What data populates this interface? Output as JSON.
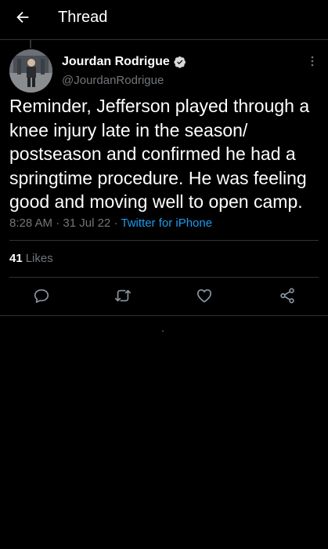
{
  "header": {
    "back_icon": "arrow-left-icon",
    "title": "Thread"
  },
  "tweet": {
    "author": {
      "display_name": "Jourdan Rodrigue",
      "handle": "@JourdanRodrigue",
      "verified": true,
      "avatar_icon": "profile-photo"
    },
    "text": "Reminder, Jefferson played through a knee injury late in the season/ postseason and confirmed he had a springtime procedure. He was feeling good and moving well to open camp.",
    "time": "8:28 AM",
    "date": "31 Jul 22",
    "separator": "·",
    "source": "Twitter for iPhone",
    "likes_count": "41",
    "likes_label": "Likes"
  },
  "actions": [
    {
      "name": "reply",
      "icon": "reply-icon"
    },
    {
      "name": "retweet",
      "icon": "retweet-icon"
    },
    {
      "name": "like",
      "icon": "heart-icon"
    },
    {
      "name": "share",
      "icon": "share-icon"
    }
  ],
  "colors": {
    "background": "#000000",
    "text": "#ffffff",
    "secondary": "#71767b",
    "link": "#1d9bf0",
    "divider": "#2f3336"
  }
}
